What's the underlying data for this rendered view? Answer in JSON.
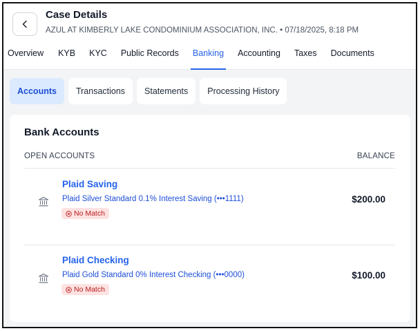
{
  "header": {
    "title": "Case Details",
    "subtitle": "AZUL AT KIMBERLY LAKE CONDOMINIUM ASSOCIATION, INC. • 07/18/2025, 8:18 PM"
  },
  "tabs": [
    {
      "label": "Overview"
    },
    {
      "label": "KYB"
    },
    {
      "label": "KYC"
    },
    {
      "label": "Public Records"
    },
    {
      "label": "Banking",
      "active": true
    },
    {
      "label": "Accounting"
    },
    {
      "label": "Taxes"
    },
    {
      "label": "Documents"
    }
  ],
  "subtabs": [
    {
      "label": "Accounts",
      "active": true
    },
    {
      "label": "Transactions"
    },
    {
      "label": "Statements"
    },
    {
      "label": "Processing History"
    }
  ],
  "card": {
    "title": "Bank Accounts",
    "col_left": "OPEN ACCOUNTS",
    "col_right": "BALANCE"
  },
  "accounts": [
    {
      "icon": "bank-icon",
      "name": "Plaid Saving",
      "description": "Plaid Silver Standard 0.1% Interest Saving (•••1111)",
      "badge": "No Match",
      "balance": "$200.00"
    },
    {
      "icon": "bank-icon",
      "name": "Plaid Checking",
      "description": "Plaid Gold Standard 0% Interest Checking (•••0000)",
      "badge": "No Match",
      "balance": "$100.00"
    }
  ],
  "colors": {
    "accent": "#2563eb",
    "badge_bg": "#fee2e2",
    "badge_text": "#b91c1c"
  }
}
